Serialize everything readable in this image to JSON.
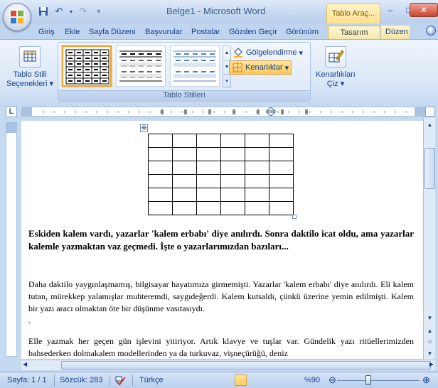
{
  "window": {
    "title": "Belge1 - Microsoft Word",
    "context_tab_title": "Tablo Araç...",
    "minimize": "–",
    "maximize": "□",
    "close": "✕"
  },
  "quick_access": {
    "save_icon": "floppy-disk-icon",
    "undo_icon": "undo-icon",
    "redo_icon": "redo-icon"
  },
  "tabs": [
    {
      "label": "Giriş"
    },
    {
      "label": "Ekle"
    },
    {
      "label": "Sayfa Düzeni"
    },
    {
      "label": "Başvurular"
    },
    {
      "label": "Postalar"
    },
    {
      "label": "Gözden Geçir"
    },
    {
      "label": "Görünüm"
    },
    {
      "label": "Tasarım",
      "active": true
    },
    {
      "label": "Düzen"
    }
  ],
  "ribbon": {
    "table_style_options": "Tablo Stili Seçenekleri",
    "table_styles_label": "Tablo Stilleri",
    "shading": "Gölgelendirme",
    "borders": "Kenarlıklar",
    "draw_borders": "Kenarlıkları Çiz"
  },
  "document": {
    "heading": "Eskiden kalem vardı, yazarlar 'kalem erbabı' diye anılırdı. Sonra daktilo icat oldu, ama yazarlar kalemle yazmaktan vaz geçmedi. İşte o yazarlarımızdan bazıları...",
    "para1": "Daha daktilo yaygınlaşmamış, bilgisayar hayatımıza girmemişti. Yazarlar 'kalem erbabı' diye anılırdı. Eli kalem tutan, mürekkep yalamışlar muhteremdi, saygıdeğerdi. Kalem kutsaldı, çünkü üzerine yemin edilmişti. Kalem bir yazı aracı olmaktan öte bir düşünme vasıtasıydı.",
    "para1_end": ".",
    "para2": "Elle yazmak her geçen gün işlevini yitiriyor. Artık klavye ve tuşlar var. Gündelik yazı ritüellerimizden bahsederken dolmakalem modellerinden ya da turkuvaz, vişneçürüğü, deniz"
  },
  "statusbar": {
    "page": "Sayfa: 1 / 1",
    "words": "Sözcük: 283",
    "language": "Türkçe",
    "zoom": "%90"
  },
  "colors": {
    "ribbon_accent": "#ffc95a",
    "context_tab": "#ffe08e"
  }
}
